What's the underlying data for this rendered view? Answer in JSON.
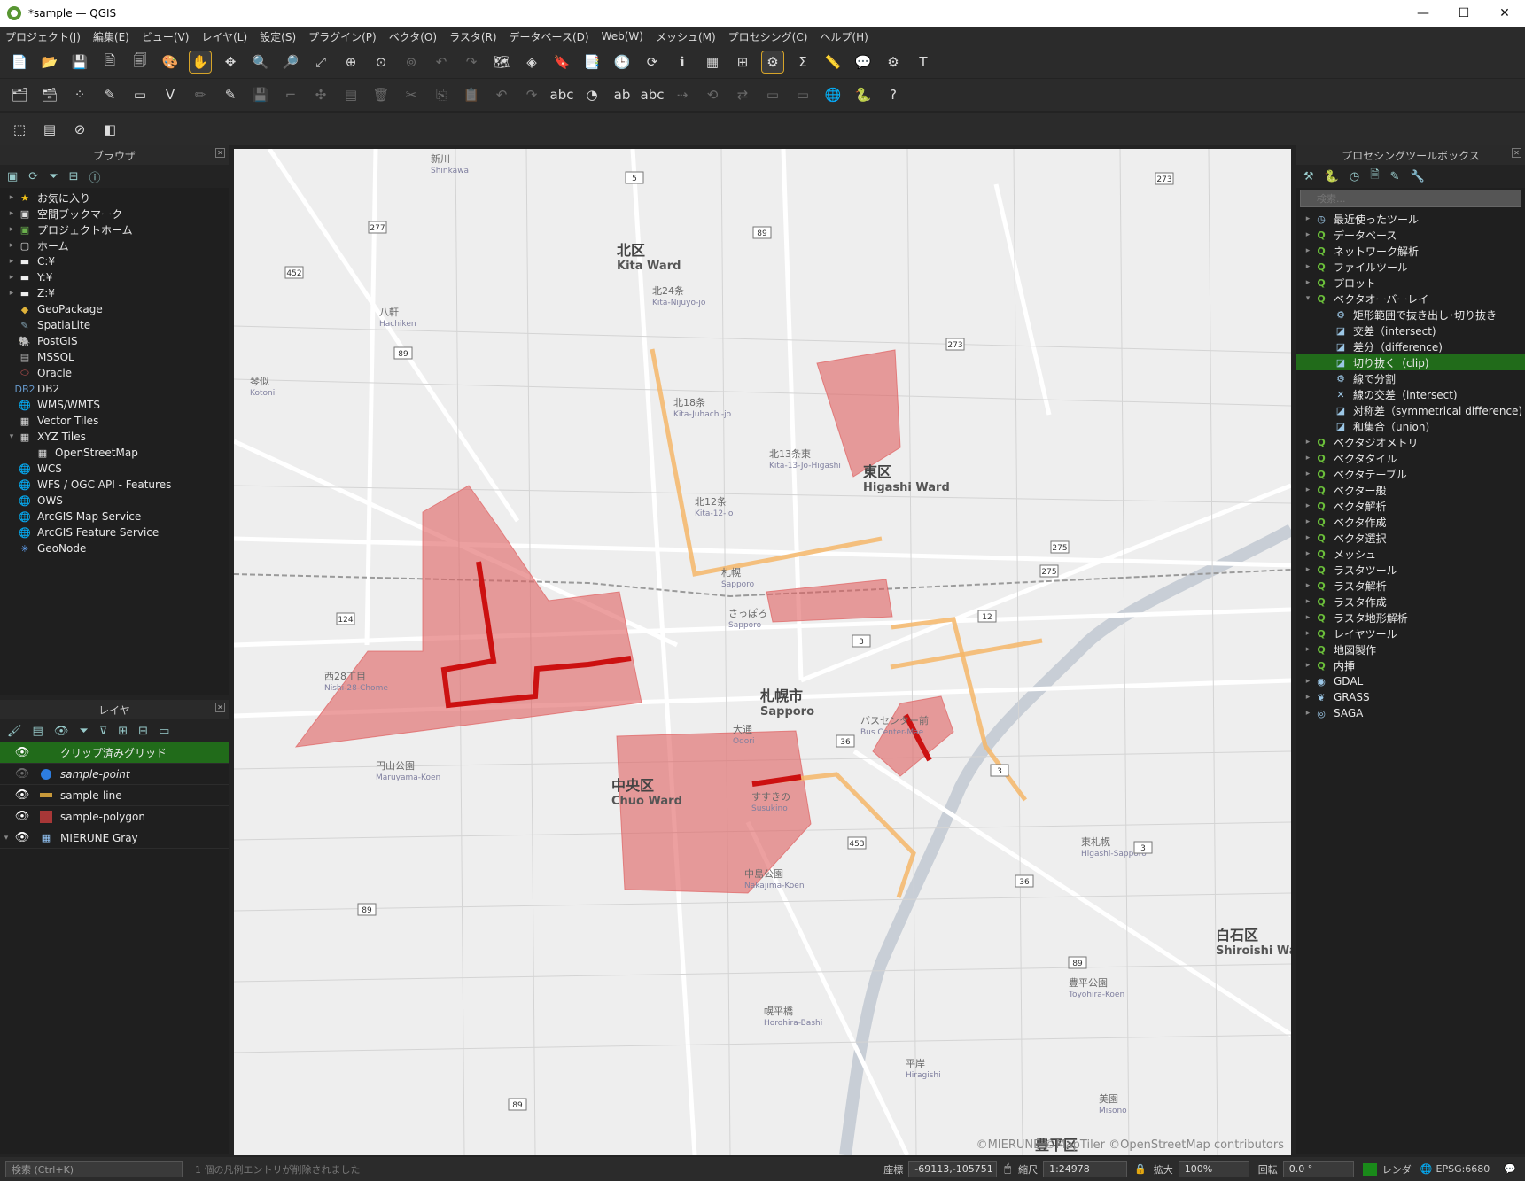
{
  "window": {
    "title": "*sample — QGIS",
    "controls": [
      "—",
      "☐",
      "✕"
    ]
  },
  "menubar": [
    "プロジェクト(J)",
    "編集(E)",
    "ビュー(V)",
    "レイヤ(L)",
    "設定(S)",
    "プラグイン(P)",
    "ベクタ(O)",
    "ラスタ(R)",
    "データベース(D)",
    "Web(W)",
    "メッシュ(M)",
    "プロセシング(C)",
    "ヘルプ(H)"
  ],
  "toolbar1": [
    {
      "name": "new-project-icon",
      "glyph": "📄"
    },
    {
      "name": "open-project-icon",
      "glyph": "📂"
    },
    {
      "name": "save-project-icon",
      "glyph": "💾"
    },
    {
      "name": "new-print-layout-icon",
      "glyph": "🗎"
    },
    {
      "name": "layout-manager-icon",
      "glyph": "🗐"
    },
    {
      "name": "style-manager-icon",
      "glyph": "🎨"
    },
    {
      "name": "pan-icon",
      "glyph": "✋",
      "active": true
    },
    {
      "name": "pan-to-selection-icon",
      "glyph": "✥"
    },
    {
      "name": "zoom-in-icon",
      "glyph": "🔍"
    },
    {
      "name": "zoom-out-icon",
      "glyph": "🔎"
    },
    {
      "name": "zoom-full-icon",
      "glyph": "⤢"
    },
    {
      "name": "zoom-selection-icon",
      "glyph": "⊕"
    },
    {
      "name": "zoom-layer-icon",
      "glyph": "⊙"
    },
    {
      "name": "zoom-native-icon",
      "glyph": "⊚",
      "dim": true
    },
    {
      "name": "zoom-last-icon",
      "glyph": "↶",
      "dim": true
    },
    {
      "name": "zoom-next-icon",
      "glyph": "↷",
      "dim": true
    },
    {
      "name": "new-map-view-icon",
      "glyph": "🗺"
    },
    {
      "name": "new-3d-view-icon",
      "glyph": "◈"
    },
    {
      "name": "new-bookmark-icon",
      "glyph": "🔖"
    },
    {
      "name": "show-bookmarks-icon",
      "glyph": "📑"
    },
    {
      "name": "temporal-icon",
      "glyph": "🕒"
    },
    {
      "name": "refresh-icon",
      "glyph": "⟳"
    },
    {
      "name": "identify-icon",
      "glyph": "ℹ"
    },
    {
      "name": "attribute-table-icon",
      "glyph": "▦"
    },
    {
      "name": "field-calculator-icon",
      "glyph": "⊞"
    },
    {
      "name": "processing-toolbox-icon",
      "glyph": "⚙",
      "active": true
    },
    {
      "name": "statistics-icon",
      "glyph": "Σ"
    },
    {
      "name": "measure-icon",
      "glyph": "📏"
    },
    {
      "name": "map-tips-icon",
      "glyph": "💬"
    },
    {
      "name": "annotation-icon",
      "glyph": "⚙"
    },
    {
      "name": "text-annotation-icon",
      "glyph": "T"
    }
  ],
  "toolbar2": [
    {
      "name": "data-source-manager-icon",
      "glyph": "🗂"
    },
    {
      "name": "new-geopackage-icon",
      "glyph": "🗃"
    },
    {
      "name": "new-temp-layer-icon",
      "glyph": "⁘"
    },
    {
      "name": "new-spatialite-icon",
      "glyph": "✎"
    },
    {
      "name": "new-virtual-layer-icon",
      "glyph": "▭"
    },
    {
      "name": "add-vector-icon",
      "glyph": "V"
    },
    {
      "name": "current-edits-icon",
      "glyph": "✏",
      "dim": true
    },
    {
      "name": "toggle-editing-icon",
      "glyph": "✎"
    },
    {
      "name": "save-edits-icon",
      "glyph": "💾",
      "dim": true
    },
    {
      "name": "digitize-icon",
      "glyph": "⌐",
      "dim": true
    },
    {
      "name": "vertex-tool-icon",
      "glyph": "✣",
      "dim": true
    },
    {
      "name": "modify-attributes-icon",
      "glyph": "▤",
      "dim": true
    },
    {
      "name": "delete-icon",
      "glyph": "🗑",
      "dim": true
    },
    {
      "name": "cut-icon",
      "glyph": "✂",
      "dim": true
    },
    {
      "name": "copy-icon",
      "glyph": "⎘",
      "dim": true
    },
    {
      "name": "paste-icon",
      "glyph": "📋",
      "dim": true
    },
    {
      "name": "undo-icon",
      "glyph": "↶",
      "dim": true
    },
    {
      "name": "redo-icon",
      "glyph": "↷",
      "dim": true
    },
    {
      "name": "label-toolbar-icon",
      "glyph": "abc"
    },
    {
      "name": "diagram-icon",
      "glyph": "◔"
    },
    {
      "name": "pin-labels-icon",
      "glyph": "ab"
    },
    {
      "name": "show-labels-icon",
      "glyph": "abc"
    },
    {
      "name": "move-label-icon",
      "glyph": "⇢",
      "dim": true
    },
    {
      "name": "rotate-label-icon",
      "glyph": "⟲",
      "dim": true
    },
    {
      "name": "change-label-icon",
      "glyph": "⇄",
      "dim": true
    },
    {
      "name": "label-prop-icon",
      "glyph": "▭",
      "dim": true
    },
    {
      "name": "label-more-icon",
      "glyph": "▭",
      "dim": true
    },
    {
      "name": "metasearch-icon",
      "glyph": "🌐"
    },
    {
      "name": "python-console-icon",
      "glyph": "🐍"
    },
    {
      "name": "help-icon",
      "glyph": "?"
    }
  ],
  "toolbar3": [
    {
      "name": "select-features-icon",
      "glyph": "⬚"
    },
    {
      "name": "select-by-attr-icon",
      "glyph": "▤"
    },
    {
      "name": "deselect-icon",
      "glyph": "⊘"
    },
    {
      "name": "select-location-icon",
      "glyph": "◧"
    }
  ],
  "browser": {
    "title": "ブラウザ",
    "items": [
      {
        "label": "お気に入り",
        "icon": "star-icon",
        "glyph": "★",
        "arrow": "▸",
        "color": "#f5c518",
        "indent": 0
      },
      {
        "label": "空間ブックマーク",
        "icon": "bookmark-icon",
        "glyph": "▣",
        "arrow": "▸",
        "color": "#ddd",
        "indent": 0
      },
      {
        "label": "プロジェクトホーム",
        "icon": "project-home-icon",
        "glyph": "▣",
        "arrow": "▸",
        "color": "#6ab04c",
        "indent": 0
      },
      {
        "label": "ホーム",
        "icon": "home-icon",
        "glyph": "▢",
        "arrow": "▸",
        "color": "#ddd",
        "indent": 0
      },
      {
        "label": "C:¥",
        "icon": "folder-icon",
        "glyph": "▬",
        "arrow": "▸",
        "color": "#eee",
        "indent": 0
      },
      {
        "label": "Y:¥",
        "icon": "folder-icon",
        "glyph": "▬",
        "arrow": "▸",
        "color": "#eee",
        "indent": 0
      },
      {
        "label": "Z:¥",
        "icon": "folder-icon",
        "glyph": "▬",
        "arrow": "▸",
        "color": "#eee",
        "indent": 0
      },
      {
        "label": "GeoPackage",
        "icon": "geopackage-icon",
        "glyph": "◆",
        "arrow": "",
        "color": "#e0b33a",
        "indent": 0
      },
      {
        "label": "SpatiaLite",
        "icon": "spatialite-icon",
        "glyph": "✎",
        "arrow": "",
        "color": "#8ab",
        "indent": 0
      },
      {
        "label": "PostGIS",
        "icon": "postgis-icon",
        "glyph": "🐘",
        "arrow": "",
        "color": "#69c",
        "indent": 0
      },
      {
        "label": "MSSQL",
        "icon": "mssql-icon",
        "glyph": "▤",
        "arrow": "",
        "color": "#aaa",
        "indent": 0
      },
      {
        "label": "Oracle",
        "icon": "oracle-icon",
        "glyph": "⬭",
        "arrow": "",
        "color": "#c55",
        "indent": 0
      },
      {
        "label": "DB2",
        "icon": "db2-icon",
        "glyph": "DB2",
        "arrow": "",
        "color": "#69c",
        "indent": 0
      },
      {
        "label": "WMS/WMTS",
        "icon": "wms-icon",
        "glyph": "🌐",
        "arrow": "",
        "color": "#ddd",
        "indent": 0
      },
      {
        "label": "Vector Tiles",
        "icon": "vector-tiles-icon",
        "glyph": "▦",
        "arrow": "",
        "color": "#ddd",
        "indent": 0
      },
      {
        "label": "XYZ Tiles",
        "icon": "xyz-tiles-icon",
        "glyph": "▦",
        "arrow": "▾",
        "color": "#ddd",
        "indent": 0
      },
      {
        "label": "OpenStreetMap",
        "icon": "xyz-layer-icon",
        "glyph": "▦",
        "arrow": "",
        "color": "#ddd",
        "indent": 1
      },
      {
        "label": "WCS",
        "icon": "wcs-icon",
        "glyph": "🌐",
        "arrow": "",
        "color": "#ddd",
        "indent": 0
      },
      {
        "label": "WFS / OGC API - Features",
        "icon": "wfs-icon",
        "glyph": "🌐",
        "arrow": "",
        "color": "#ddd",
        "indent": 0
      },
      {
        "label": "OWS",
        "icon": "ows-icon",
        "glyph": "🌐",
        "arrow": "",
        "color": "#ddd",
        "indent": 0
      },
      {
        "label": "ArcGIS Map Service",
        "icon": "arcgis-map-icon",
        "glyph": "🌐",
        "arrow": "",
        "color": "#ddd",
        "indent": 0
      },
      {
        "label": "ArcGIS Feature Service",
        "icon": "arcgis-feature-icon",
        "glyph": "🌐",
        "arrow": "",
        "color": "#ddd",
        "indent": 0
      },
      {
        "label": "GeoNode",
        "icon": "geonode-icon",
        "glyph": "✳",
        "arrow": "",
        "color": "#6af",
        "indent": 0
      }
    ]
  },
  "layers": {
    "title": "レイヤ",
    "items": [
      {
        "label": "クリップ済みグリッド",
        "symbol": "grid",
        "visible": true,
        "selected": true
      },
      {
        "label": "sample-point",
        "symbol": "point",
        "visible": false,
        "selected": false
      },
      {
        "label": "sample-line",
        "symbol": "line",
        "visible": true,
        "selected": false
      },
      {
        "label": "sample-polygon",
        "symbol": "polygon",
        "visible": true,
        "selected": false
      },
      {
        "label": "MIERUNE Gray",
        "symbol": "tiles",
        "visible": true,
        "selected": false
      }
    ]
  },
  "processing": {
    "title": "プロセシングツールボックス",
    "search_placeholder": "検索...",
    "items": [
      {
        "label": "最近使ったツール",
        "arrow": "▸",
        "icon": "clock-icon",
        "glyph": "◷",
        "indent": 0
      },
      {
        "label": "データベース",
        "arrow": "▸",
        "icon": "qgis-icon",
        "glyph": "Q",
        "indent": 0
      },
      {
        "label": "ネットワーク解析",
        "arrow": "▸",
        "icon": "qgis-icon",
        "glyph": "Q",
        "indent": 0
      },
      {
        "label": "ファイルツール",
        "arrow": "▸",
        "icon": "qgis-icon",
        "glyph": "Q",
        "indent": 0
      },
      {
        "label": "プロット",
        "arrow": "▸",
        "icon": "qgis-icon",
        "glyph": "Q",
        "indent": 0
      },
      {
        "label": "ベクタオーバーレイ",
        "arrow": "▾",
        "icon": "qgis-icon",
        "glyph": "Q",
        "indent": 0
      },
      {
        "label": "矩形範囲で抜き出し･切り抜き",
        "arrow": "",
        "icon": "gear-icon",
        "glyph": "⚙",
        "indent": 1
      },
      {
        "label": "交差（intersect)",
        "arrow": "",
        "icon": "intersect-icon",
        "glyph": "◪",
        "indent": 1
      },
      {
        "label": "差分（difference)",
        "arrow": "",
        "icon": "difference-icon",
        "glyph": "◪",
        "indent": 1
      },
      {
        "label": "切り抜く（clip)",
        "arrow": "",
        "icon": "clip-icon",
        "glyph": "◪",
        "indent": 1,
        "selected": true
      },
      {
        "label": "線で分割",
        "arrow": "",
        "icon": "gear-icon",
        "glyph": "⚙",
        "indent": 1
      },
      {
        "label": "線の交差（intersect)",
        "arrow": "",
        "icon": "line-intersect-icon",
        "glyph": "✕",
        "indent": 1
      },
      {
        "label": "対称差（symmetrical difference)",
        "arrow": "",
        "icon": "symdiff-icon",
        "glyph": "◪",
        "indent": 1
      },
      {
        "label": "和集合（union)",
        "arrow": "",
        "icon": "union-icon",
        "glyph": "◪",
        "indent": 1
      },
      {
        "label": "ベクタジオメトリ",
        "arrow": "▸",
        "icon": "qgis-icon",
        "glyph": "Q",
        "indent": 0
      },
      {
        "label": "ベクタタイル",
        "arrow": "▸",
        "icon": "qgis-icon",
        "glyph": "Q",
        "indent": 0
      },
      {
        "label": "ベクタテーブル",
        "arrow": "▸",
        "icon": "qgis-icon",
        "glyph": "Q",
        "indent": 0
      },
      {
        "label": "ベクター般",
        "arrow": "▸",
        "icon": "qgis-icon",
        "glyph": "Q",
        "indent": 0
      },
      {
        "label": "ベクタ解析",
        "arrow": "▸",
        "icon": "qgis-icon",
        "glyph": "Q",
        "indent": 0
      },
      {
        "label": "ベクタ作成",
        "arrow": "▸",
        "icon": "qgis-icon",
        "glyph": "Q",
        "indent": 0
      },
      {
        "label": "ベクタ選択",
        "arrow": "▸",
        "icon": "qgis-icon",
        "glyph": "Q",
        "indent": 0
      },
      {
        "label": "メッシュ",
        "arrow": "▸",
        "icon": "qgis-icon",
        "glyph": "Q",
        "indent": 0
      },
      {
        "label": "ラスタツール",
        "arrow": "▸",
        "icon": "qgis-icon",
        "glyph": "Q",
        "indent": 0
      },
      {
        "label": "ラスタ解析",
        "arrow": "▸",
        "icon": "qgis-icon",
        "glyph": "Q",
        "indent": 0
      },
      {
        "label": "ラスタ作成",
        "arrow": "▸",
        "icon": "qgis-icon",
        "glyph": "Q",
        "indent": 0
      },
      {
        "label": "ラスタ地形解析",
        "arrow": "▸",
        "icon": "qgis-icon",
        "glyph": "Q",
        "indent": 0
      },
      {
        "label": "レイヤツール",
        "arrow": "▸",
        "icon": "qgis-icon",
        "glyph": "Q",
        "indent": 0
      },
      {
        "label": "地図製作",
        "arrow": "▸",
        "icon": "qgis-icon",
        "glyph": "Q",
        "indent": 0
      },
      {
        "label": "内挿",
        "arrow": "▸",
        "icon": "qgis-icon",
        "glyph": "Q",
        "indent": 0
      },
      {
        "label": "GDAL",
        "arrow": "▸",
        "icon": "gdal-icon",
        "glyph": "◉",
        "indent": 0
      },
      {
        "label": "GRASS",
        "arrow": "▸",
        "icon": "grass-icon",
        "glyph": "❦",
        "indent": 0
      },
      {
        "label": "SAGA",
        "arrow": "▸",
        "icon": "saga-icon",
        "glyph": "◎",
        "indent": 0
      }
    ]
  },
  "status": {
    "search_placeholder": "検索 (Ctrl+K)",
    "message": "1 個の凡例エントリが削除されました",
    "coord_label": "座標",
    "coord_value": "-69113,-105751",
    "scale_label": "縮尺",
    "scale_value": "1:24978",
    "magnifier_label": "拡大",
    "magnifier_value": "100%",
    "rotation_label": "回転",
    "rotation_value": "0.0 °",
    "render_label": "レンダ",
    "crs_value": "EPSG:6680"
  },
  "map": {
    "attribution": "©MIERUNE ©MapTiler ©OpenStreetMap contributors",
    "labels": [
      {
        "t": "北区",
        "s": "Kita Ward",
        "big": true
      },
      {
        "t": "東区",
        "s": "Higashi Ward",
        "big": true
      },
      {
        "t": "中央区",
        "s": "Chuo Ward",
        "big": true
      },
      {
        "t": "白石区",
        "s": "Shiroishi Ward",
        "big": true
      },
      {
        "t": "豊平区",
        "s": "",
        "big": true
      },
      {
        "t": "札幌市",
        "s": "Sapporo",
        "big": true
      },
      {
        "t": "新川",
        "s": "Shinkawa"
      },
      {
        "t": "北24条",
        "s": "Kita-Nijuyo-jo"
      },
      {
        "t": "八軒",
        "s": "Hachiken"
      },
      {
        "t": "琴似",
        "s": "Kotoni"
      },
      {
        "t": "北18条",
        "s": "Kita-Juhachi-jo"
      },
      {
        "t": "北13条東",
        "s": "Kita-13-Jo-Higashi"
      },
      {
        "t": "北12条",
        "s": "Kita-12-jo"
      },
      {
        "t": "札幌",
        "s": "Sapporo"
      },
      {
        "t": "さっぽろ",
        "s": "Sapporo"
      },
      {
        "t": "西28丁目",
        "s": "Nishi-28-Chome"
      },
      {
        "t": "大通",
        "s": "Odori"
      },
      {
        "t": "バスセンター前",
        "s": "Bus Center-Mae"
      },
      {
        "t": "円山公園",
        "s": "Maruyama-Koen"
      },
      {
        "t": "すすきの",
        "s": "Susukino"
      },
      {
        "t": "中島公園",
        "s": "Nakajima-Koen"
      },
      {
        "t": "東札幌",
        "s": "Higashi-Sapporo"
      },
      {
        "t": "豊平公園",
        "s": "Toyohira-Koen"
      },
      {
        "t": "幌平橋",
        "s": "Horohira-Bashi"
      },
      {
        "t": "平岸",
        "s": "Hiragishi"
      },
      {
        "t": "美園",
        "s": "Misono"
      }
    ],
    "routes": [
      "5",
      "273",
      "277",
      "452",
      "89",
      "89",
      "273",
      "275",
      "275",
      "124",
      "12",
      "3",
      "3",
      "36",
      "453",
      "3",
      "36",
      "89",
      "89",
      "89"
    ]
  }
}
